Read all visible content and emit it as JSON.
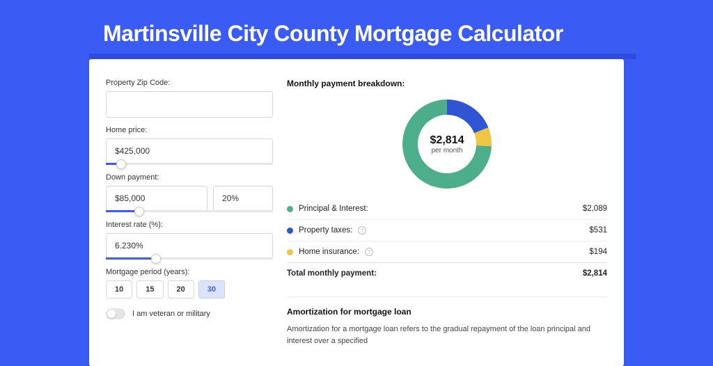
{
  "page_title": "Martinsville City County Mortgage Calculator",
  "form": {
    "zip": {
      "label": "Property Zip Code:",
      "value": ""
    },
    "home_price": {
      "label": "Home price:",
      "value": "$425,000",
      "slider_pct": 9
    },
    "down_payment": {
      "label": "Down payment:",
      "amount": "$85,000",
      "percent": "20%",
      "slider_pct": 20
    },
    "interest_rate": {
      "label": "Interest rate (%):",
      "value": "6.230%",
      "slider_pct": 30
    },
    "period": {
      "label": "Mortgage period (years):",
      "options": [
        "10",
        "15",
        "20",
        "30"
      ],
      "selected": "30"
    },
    "veteran": {
      "label": "I am veteran or military",
      "checked": false
    }
  },
  "breakdown": {
    "title": "Monthly payment breakdown:",
    "total_amount": "$2,814",
    "total_sub": "per month",
    "items": [
      {
        "key": "principal",
        "label": "Principal & Interest:",
        "value": "$2,089",
        "color": "#4DAE8C",
        "has_info": false
      },
      {
        "key": "taxes",
        "label": "Property taxes:",
        "value": "$531",
        "color": "#2F55D4",
        "has_info": true
      },
      {
        "key": "insurance",
        "label": "Home insurance:",
        "value": "$194",
        "color": "#EEC643",
        "has_info": true
      }
    ],
    "total_row": {
      "label": "Total monthly payment:",
      "value": "$2,814"
    }
  },
  "amortization": {
    "title": "Amortization for mortgage loan",
    "text": "Amortization for a mortgage loan refers to the gradual repayment of the loan principal and interest over a specified"
  },
  "chart_data": {
    "type": "pie",
    "title": "Monthly payment breakdown:",
    "series": [
      {
        "name": "Principal & Interest",
        "value": 2089,
        "color": "#4DAE8C"
      },
      {
        "name": "Property taxes",
        "value": 531,
        "color": "#2F55D4"
      },
      {
        "name": "Home insurance",
        "value": 194,
        "color": "#EEC643"
      }
    ],
    "total": 2814,
    "center_label": "$2,814",
    "center_sublabel": "per month"
  }
}
